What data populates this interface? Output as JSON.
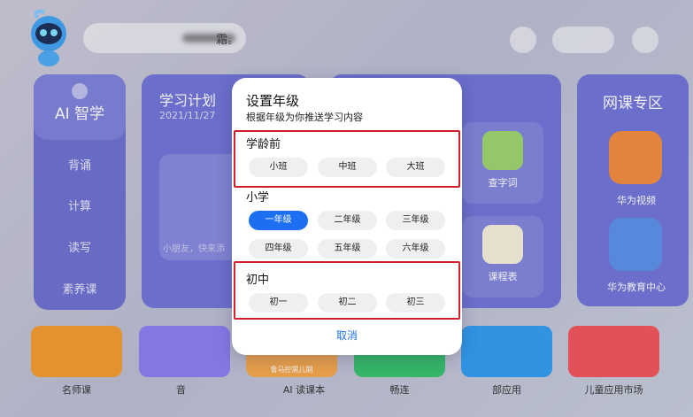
{
  "greeting": "霜。",
  "sidebar": {
    "ai_label": "AI 智学",
    "items": [
      "背诵",
      "计算",
      "读写",
      "素养课"
    ]
  },
  "study_plan": {
    "title": "学习计划",
    "date": "2021/11/27",
    "hint": "小朋友，快来添"
  },
  "mid_tiles": [
    {
      "label": "查字词"
    },
    {
      "label": "课程表"
    }
  ],
  "net_course": {
    "title": "网课专区",
    "apps": [
      {
        "label": "华为视频"
      },
      {
        "label": "华为教育中心"
      }
    ]
  },
  "dock": [
    {
      "label": "名师课"
    },
    {
      "label": "音"
    },
    {
      "label": "AI 读课本",
      "sub": "鲁马控需儿期"
    },
    {
      "label": "畅连"
    },
    {
      "label": "部应用"
    },
    {
      "label": "儿童应用市场"
    }
  ],
  "dialog": {
    "title": "设置年级",
    "subtitle": "根据年级为你推送学习内容",
    "sections": [
      {
        "title": "学龄前",
        "options": [
          "小班",
          "中班",
          "大班"
        ]
      },
      {
        "title": "小学",
        "options": [
          "一年级",
          "二年级",
          "三年级",
          "四年级",
          "五年级",
          "六年级"
        ]
      },
      {
        "title": "初中",
        "options": [
          "初一",
          "初二",
          "初三"
        ]
      }
    ],
    "selected": "一年级",
    "cancel": "取消"
  },
  "colors": {
    "accent": "#1d6ff2",
    "highlight_box": "#d11f2d",
    "card_purple": "#6f74d6"
  }
}
